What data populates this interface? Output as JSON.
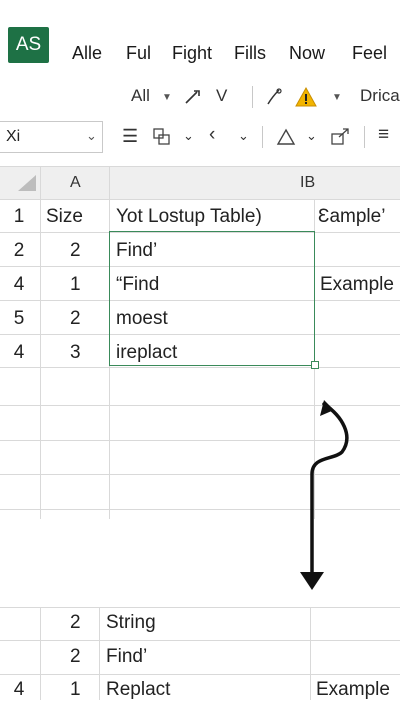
{
  "app": {
    "badge": "AS"
  },
  "menu": [
    "Alle",
    "Ful",
    "Fight",
    "Fills",
    "Now",
    "Feel"
  ],
  "toolbar2": {
    "font_dropdown": "All",
    "italic_glyph": "V",
    "font_name": "Drica"
  },
  "toolbar3": {
    "name_box": "Xi"
  },
  "grid": {
    "col_a": "A",
    "col_b": "IB",
    "rows": [
      {
        "row": "1",
        "a": "Size",
        "b": "Yot Lostup Table)",
        "c": "Ɛample’"
      },
      {
        "row": "2",
        "a": "2",
        "b": "Find’",
        "c": ""
      },
      {
        "row": "4",
        "a": "1",
        "b": "“Find",
        "c": "Example"
      },
      {
        "row": "5",
        "a": "2",
        "b": "moest",
        "c": ""
      },
      {
        "row": "4",
        "a": "3",
        "b": "ireplact",
        "c": ""
      }
    ]
  },
  "lower_grid": {
    "rows": [
      {
        "row": "",
        "a": "2",
        "b": "String",
        "c": ""
      },
      {
        "row": "",
        "a": "2",
        "b": "Find’",
        "c": ""
      },
      {
        "row": "4",
        "a": "1",
        "b": "Replact",
        "c": "Example"
      }
    ]
  },
  "colors": {
    "brand": "#1e7145",
    "selection": "#3a8a5a",
    "warning": "#f2b400"
  }
}
